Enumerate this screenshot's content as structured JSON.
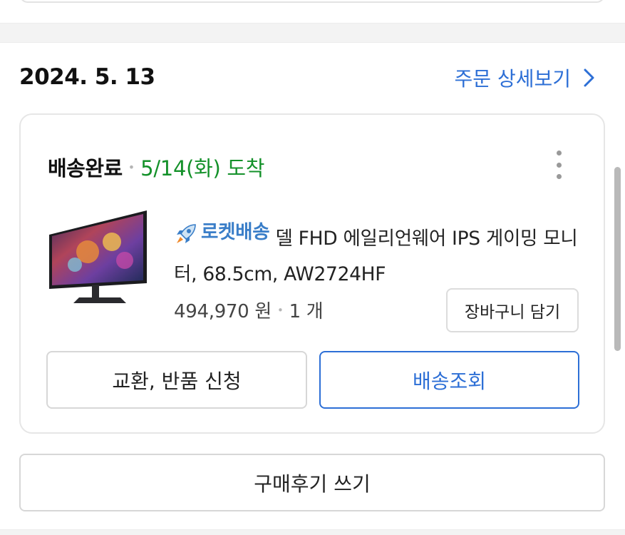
{
  "order": {
    "date": "2024. 5. 13",
    "detail_link": "주문 상세보기"
  },
  "shipment": {
    "status": "배송완료",
    "arrival": "5/14(화) 도착"
  },
  "product": {
    "badge": "로켓배송",
    "name": "델 FHD 에일리언웨어 IPS 게이밍 모니터, 68.5cm, AW2724HF",
    "price": "494,970 원",
    "quantity": "1 개"
  },
  "buttons": {
    "add_to_cart": "장바구니 담기",
    "exchange_return": "교환, 반품 신청",
    "track_delivery": "배송조회",
    "write_review": "구매후기 쓰기"
  },
  "colors": {
    "link_blue": "#2d6fd6",
    "arrival_green": "#14912a",
    "rocket_blue": "#3a7ec8"
  },
  "icons": {
    "detail_link_icon": "chevron-right-icon",
    "menu_icon": "more-vertical-icon",
    "badge_icon": "rocket-icon"
  }
}
